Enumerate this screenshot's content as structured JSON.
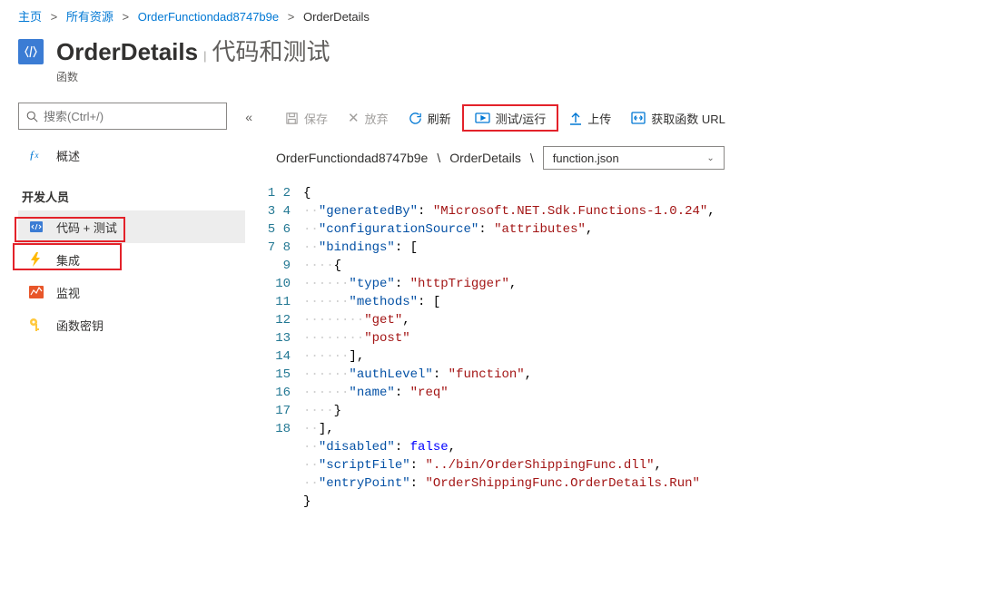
{
  "breadcrumb": [
    {
      "label": "主页",
      "link": true
    },
    {
      "label": "所有资源",
      "link": true
    },
    {
      "label": "OrderFunctiondad8747b9e",
      "link": true
    },
    {
      "label": "OrderDetails",
      "link": false
    }
  ],
  "header": {
    "title": "OrderDetails",
    "subtitle": "代码和测试",
    "type": "函数"
  },
  "sidebar": {
    "search_placeholder": "搜索(Ctrl+/)",
    "overview": "概述",
    "dev_section": "开发人员",
    "items": [
      {
        "label": "代码 + 测试",
        "icon": "code",
        "selected": true
      },
      {
        "label": "集成",
        "icon": "bolt"
      },
      {
        "label": "监视",
        "icon": "monitor"
      },
      {
        "label": "函数密钥",
        "icon": "key"
      }
    ]
  },
  "toolbar": {
    "save": "保存",
    "discard": "放弃",
    "refresh": "刷新",
    "test_run": "测试/运行",
    "upload": "上传",
    "get_url": "获取函数 URL"
  },
  "pathbar": {
    "p1": "OrderFunctiondad8747b9e",
    "p2": "OrderDetails",
    "file": "function.json"
  },
  "code": {
    "lines": 18,
    "generatedBy_k": "\"generatedBy\"",
    "generatedBy_v": "\"Microsoft.NET.Sdk.Functions-1.0.24\"",
    "configSource_k": "\"configurationSource\"",
    "configSource_v": "\"attributes\"",
    "bindings_k": "\"bindings\"",
    "type_k": "\"type\"",
    "type_v": "\"httpTrigger\"",
    "methods_k": "\"methods\"",
    "get_v": "\"get\"",
    "post_v": "\"post\"",
    "authLevel_k": "\"authLevel\"",
    "authLevel_v": "\"function\"",
    "name_k": "\"name\"",
    "name_v": "\"req\"",
    "disabled_k": "\"disabled\"",
    "disabled_v": "false",
    "scriptFile_k": "\"scriptFile\"",
    "scriptFile_v": "\"../bin/OrderShippingFunc.dll\"",
    "entryPoint_k": "\"entryPoint\"",
    "entryPoint_v": "\"OrderShippingFunc.OrderDetails.Run\""
  }
}
